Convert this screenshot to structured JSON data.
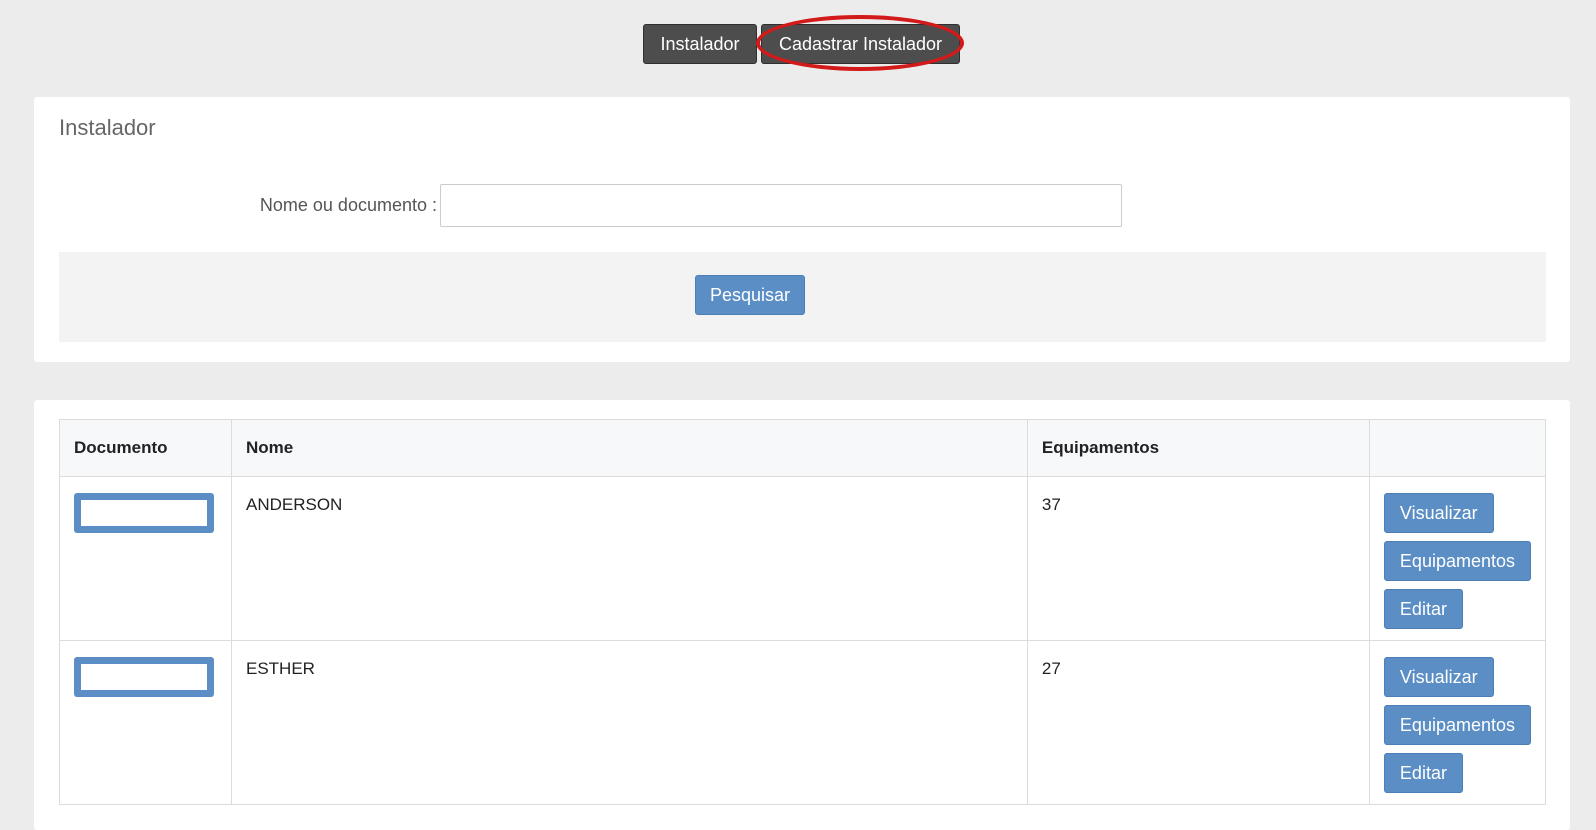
{
  "topnav": {
    "instalador_label": "Instalador",
    "cadastrar_label": "Cadastrar Instalador"
  },
  "search": {
    "title": "Instalador",
    "field_label": "Nome ou documento :",
    "field_value": "",
    "button_label": "Pesquisar"
  },
  "table": {
    "headers": [
      "Documento",
      "Nome",
      "Equipamentos",
      ""
    ],
    "rows": [
      {
        "nome": "ANDERSON",
        "equipamentos": "37",
        "actions": [
          "Visualizar",
          "Equipamentos",
          "Editar"
        ]
      },
      {
        "nome": "ESTHER",
        "equipamentos": "27",
        "actions": [
          "Visualizar",
          "Equipamentos",
          "Editar"
        ]
      }
    ]
  },
  "colors": {
    "primary": "#5b8ec5",
    "nav_dark": "#4d4d4d",
    "highlight": "#d31a1a",
    "background": "#ececec"
  }
}
